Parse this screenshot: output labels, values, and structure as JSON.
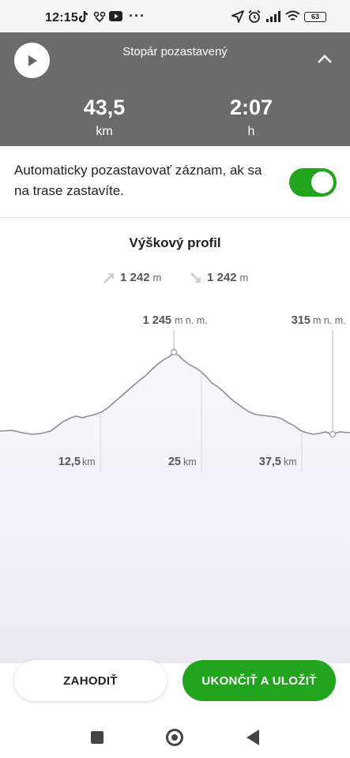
{
  "status_bar": {
    "time": "12:15",
    "overflow": "···",
    "battery": "63"
  },
  "header": {
    "title": "Stopár pozastavený",
    "distance_value": "43,5",
    "distance_unit": "km",
    "duration_value": "2:07",
    "duration_unit": "h"
  },
  "auto_pause": {
    "label": "Automaticky pozastavovať záznam, ak sa na trase zastavíte.",
    "enabled": true
  },
  "elevation_profile": {
    "title": "Výškový profil",
    "ascent_value": "1 242",
    "ascent_unit": "m",
    "descent_value": "1 242",
    "descent_unit": "m",
    "max_value": "1 245",
    "max_unit": "m n. m.",
    "current_value": "315",
    "current_unit": "m n. m.",
    "km_ticks": [
      {
        "value": "12,5",
        "unit": "km"
      },
      {
        "value": "25",
        "unit": "km"
      },
      {
        "value": "37,5",
        "unit": "km"
      }
    ]
  },
  "actions": {
    "discard": "ZAHODIŤ",
    "save": "UKONČIŤ A ULOŽIŤ"
  },
  "colors": {
    "accent": "#23a41f",
    "header_bg": "#6b6b6b"
  }
}
